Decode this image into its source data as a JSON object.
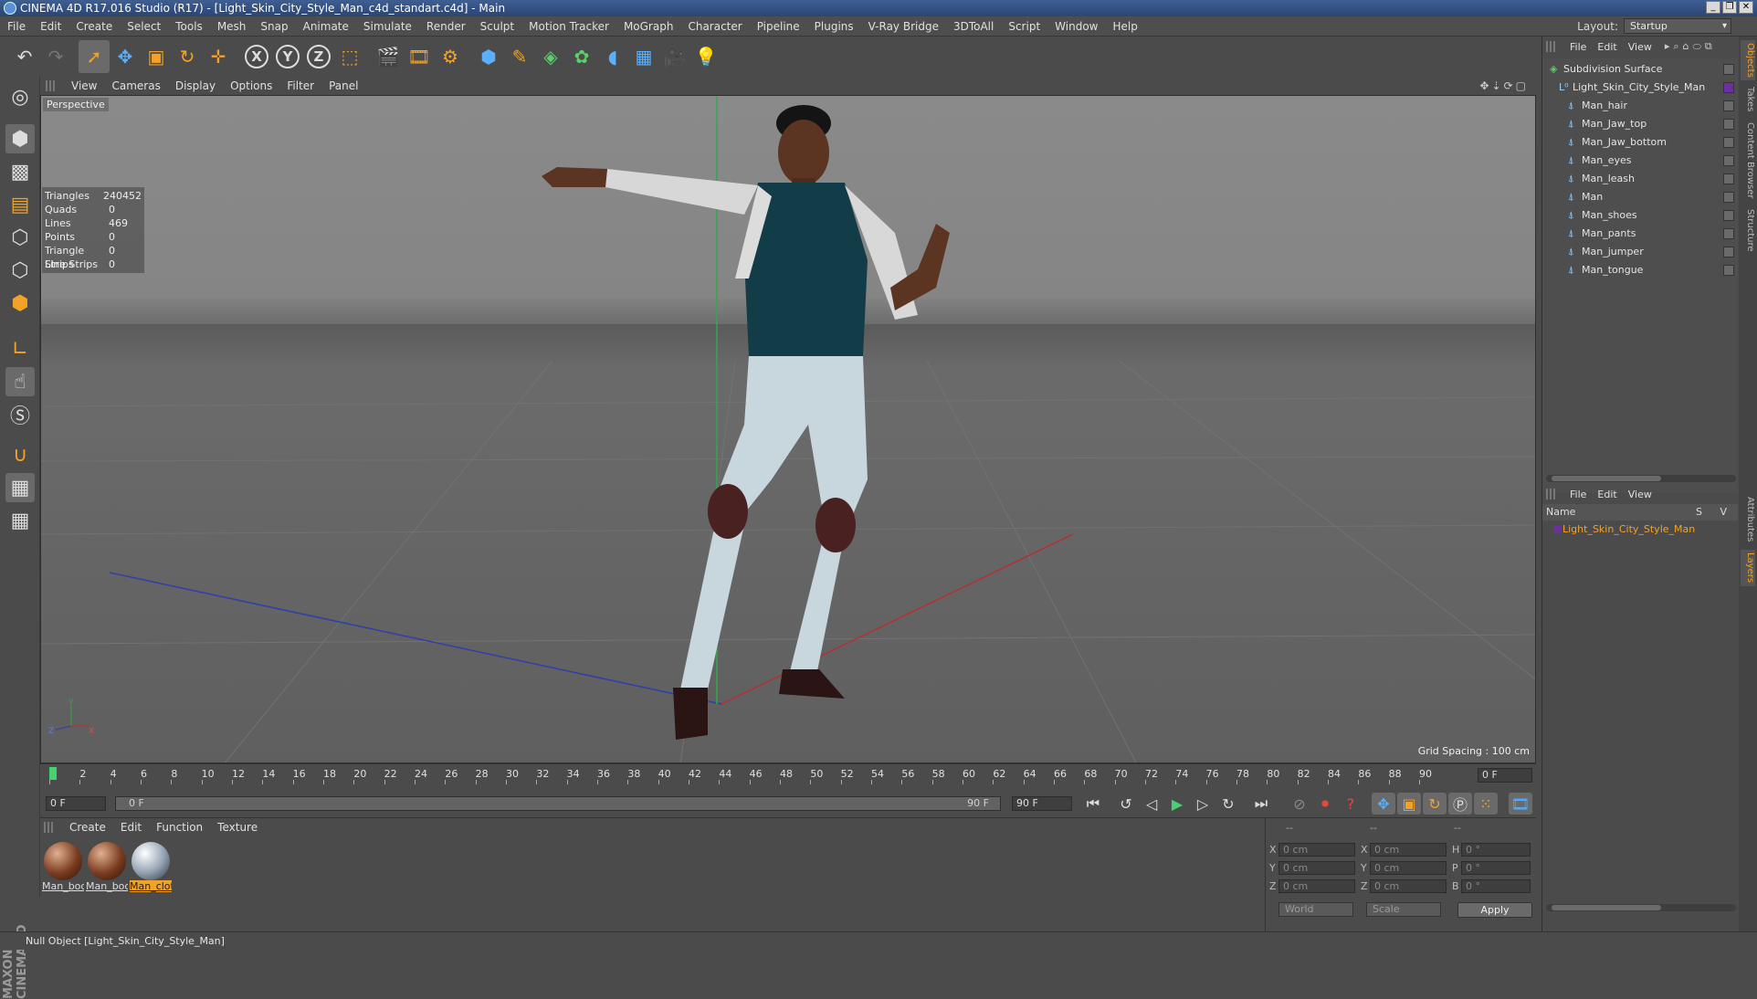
{
  "window": {
    "title": "CINEMA 4D R17.016 Studio (R17) - [Light_Skin_City_Style_Man_c4d_standart.c4d] - Main",
    "buttons": [
      "_",
      "❐",
      "✕"
    ]
  },
  "menubar": {
    "items": [
      "File",
      "Edit",
      "Create",
      "Select",
      "Tools",
      "Mesh",
      "Snap",
      "Animate",
      "Simulate",
      "Render",
      "Sculpt",
      "Motion Tracker",
      "MoGraph",
      "Character",
      "Pipeline",
      "Plugins",
      "V-Ray Bridge",
      "3DToAll",
      "Script",
      "Window",
      "Help"
    ],
    "layout_label": "Layout:",
    "layout_value": "Startup"
  },
  "viewport": {
    "menu": [
      "View",
      "Cameras",
      "Display",
      "Options",
      "Filter",
      "Panel"
    ],
    "camera_label": "Perspective",
    "stats": [
      {
        "k": "Triangles",
        "v": "240452"
      },
      {
        "k": "Quads",
        "v": "0"
      },
      {
        "k": "Lines",
        "v": "469"
      },
      {
        "k": "Points",
        "v": "0"
      },
      {
        "k": "Triangle Strips",
        "v": "0"
      },
      {
        "k": "Line Strips",
        "v": "0"
      }
    ],
    "grid_spacing": "Grid Spacing : 100 cm",
    "axis": {
      "y": "Y",
      "z": "Z",
      "x": "X"
    }
  },
  "timeline": {
    "ticks": [
      "0",
      "2",
      "4",
      "6",
      "8",
      "10",
      "12",
      "14",
      "16",
      "18",
      "20",
      "22",
      "24",
      "26",
      "28",
      "30",
      "32",
      "34",
      "36",
      "38",
      "40",
      "42",
      "44",
      "46",
      "48",
      "50",
      "52",
      "54",
      "56",
      "58",
      "60",
      "62",
      "64",
      "66",
      "68",
      "70",
      "72",
      "74",
      "76",
      "78",
      "80",
      "82",
      "84",
      "86",
      "88",
      "90"
    ],
    "current_frame": "0 F",
    "start_field": "0 F",
    "slider_start": "0 F",
    "slider_end": "90 F",
    "end_field": "90 F"
  },
  "materials": {
    "menu": [
      "Create",
      "Edit",
      "Function",
      "Texture"
    ],
    "items": [
      {
        "label": "Man_boc",
        "type": "skin"
      },
      {
        "label": "Man_boc",
        "type": "skin"
      },
      {
        "label": "Man_clot",
        "type": "cloth",
        "selected": true
      }
    ]
  },
  "coords": {
    "headers": [
      "--",
      "--",
      "--"
    ],
    "rows": [
      {
        "a": "X",
        "v1": "0 cm",
        "b": "X",
        "v2": "0 cm",
        "c": "H",
        "v3": "0 °"
      },
      {
        "a": "Y",
        "v1": "0 cm",
        "b": "Y",
        "v2": "0 cm",
        "c": "P",
        "v3": "0 °"
      },
      {
        "a": "Z",
        "v1": "0 cm",
        "b": "Z",
        "v2": "0 cm",
        "c": "B",
        "v3": "0 °"
      }
    ],
    "mode1": "World",
    "mode2": "Scale",
    "apply": "Apply"
  },
  "status": "Null Object [Light_Skin_City_Style_Man]",
  "objects": {
    "menu": [
      "File",
      "Edit",
      "View"
    ],
    "items": [
      {
        "name": "Subdivision Surface",
        "level": 0,
        "icon": "subdivision-icon"
      },
      {
        "name": "Light_Skin_City_Style_Man",
        "level": 1,
        "icon": "null-icon"
      },
      {
        "name": "Man_hair",
        "level": 2,
        "icon": "polygon-icon"
      },
      {
        "name": "Man_Jaw_top",
        "level": 2,
        "icon": "polygon-icon"
      },
      {
        "name": "Man_Jaw_bottom",
        "level": 2,
        "icon": "polygon-icon"
      },
      {
        "name": "Man_eyes",
        "level": 2,
        "icon": "polygon-icon"
      },
      {
        "name": "Man_leash",
        "level": 2,
        "icon": "polygon-icon"
      },
      {
        "name": "Man",
        "level": 2,
        "icon": "polygon-icon"
      },
      {
        "name": "Man_shoes",
        "level": 2,
        "icon": "polygon-icon"
      },
      {
        "name": "Man_pants",
        "level": 2,
        "icon": "polygon-icon"
      },
      {
        "name": "Man_jumper",
        "level": 2,
        "icon": "polygon-icon"
      },
      {
        "name": "Man_tongue",
        "level": 2,
        "icon": "polygon-icon"
      }
    ]
  },
  "layers": {
    "menu": [
      "File",
      "Edit",
      "View"
    ],
    "col_name": "Name",
    "col_flags": "S V",
    "item": "Light_Skin_City_Style_Man"
  },
  "sidetabs": [
    "Objects",
    "Takes",
    "Content Browser",
    "Structure",
    "Attributes",
    "Layers"
  ],
  "colors": {
    "accent": "#f3a228",
    "play": "#48d170",
    "layer": "#6a2fa0"
  }
}
